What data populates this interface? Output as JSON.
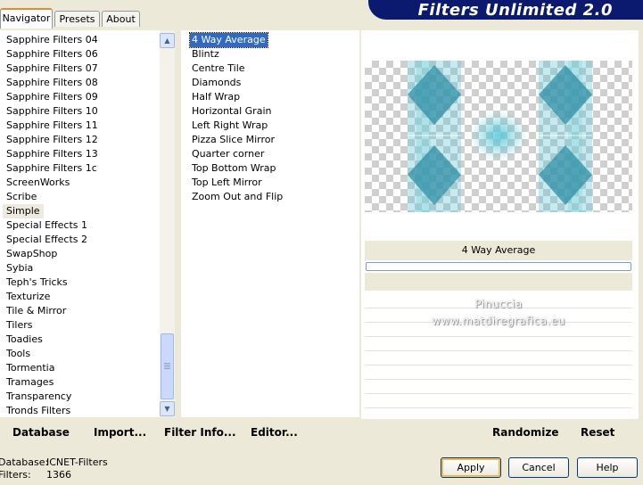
{
  "tabs": [
    {
      "label": "Navigator",
      "active": true
    },
    {
      "label": "Presets",
      "active": false
    },
    {
      "label": "About",
      "active": false
    }
  ],
  "app_title": "Filters Unlimited 2.0",
  "categories": [
    "Sapphire Filters 04",
    "Sapphire Filters 06",
    "Sapphire Filters 07",
    "Sapphire Filters 08",
    "Sapphire Filters 09",
    "Sapphire Filters 10",
    "Sapphire Filters 11",
    "Sapphire Filters 12",
    "Sapphire Filters 13",
    "Sapphire Filters 1c",
    "ScreenWorks",
    "Scribe",
    "Simple",
    "Special Effects 1",
    "Special Effects 2",
    "SwapShop",
    "Sybia",
    "Teph's Tricks",
    "Texturize",
    "Tile & Mirror",
    "Tilers",
    "Toadies",
    "Tools",
    "Tormentia",
    "Tramages",
    "Transparency",
    "Tronds Filters"
  ],
  "selected_category": "Simple",
  "filters": [
    "4 Way Average",
    "Blintz",
    "Centre Tile",
    "Diamonds",
    "Half Wrap",
    "Horizontal Grain",
    "Left Right Wrap",
    "Pizza Slice Mirror",
    "Quarter corner",
    "Top Bottom Wrap",
    "Top Left Mirror",
    "Zoom Out and Flip"
  ],
  "selected_filter": "4 Way Average",
  "preview": {
    "filter_name": "4 Way Average",
    "watermark_line1": "Pinuccia",
    "watermark_line2": "www.matdiregrafica.eu"
  },
  "toolbar": {
    "database": "Database",
    "import": "Import...",
    "filter_info": "Filter Info...",
    "editor": "Editor...",
    "randomize": "Randomize",
    "reset": "Reset"
  },
  "status": {
    "database_label": "Database:",
    "database_value": "ICNET-Filters",
    "filters_label": "Filters:",
    "filters_value": "1366"
  },
  "buttons": {
    "apply": "Apply",
    "cancel": "Cancel",
    "help": "Help"
  },
  "icons": {
    "scroll_up": "chevron-up-icon",
    "scroll_down": "chevron-down-icon"
  },
  "colors": {
    "banner": "#0b1a6e",
    "selection": "#316ac5",
    "active_tab": "#e68b2c",
    "preview_teal": "#3aa8b8"
  }
}
